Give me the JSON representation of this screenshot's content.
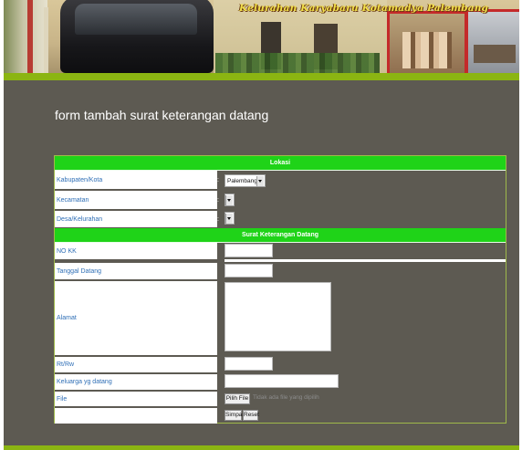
{
  "banner": {
    "title": "Kelurahan Karyabaru Kotamadya Palembang"
  },
  "form": {
    "title": "form tambah surat keterangan datang",
    "section_location": "Lokasi",
    "section_letter": "Surat Keterangan Datang",
    "colon": ":",
    "fields": {
      "kabupaten": {
        "label": "Kabupaten/Kota",
        "value": "Palembang"
      },
      "kecamatan": {
        "label": "Kecamatan",
        "value": ""
      },
      "kelurahan": {
        "label": "Desa/Kelurahan",
        "value": ""
      },
      "no_kk": {
        "label": "NO KK",
        "value": ""
      },
      "tanggal": {
        "label": "Tanggal Datang",
        "value": ""
      },
      "alamat": {
        "label": "Alamat",
        "value": ""
      },
      "rt_rw": {
        "label": "Rt/Rw",
        "value": ""
      },
      "keluarga": {
        "label": "Keluarga yg datang",
        "value": ""
      },
      "file": {
        "label": "File",
        "button": "Pilih File",
        "status": "Tidak ada file yang dipilih"
      }
    },
    "buttons": {
      "save": "Simpan",
      "reset": "Reset"
    }
  },
  "colors": {
    "page_bg": "#5d5a52",
    "section_header": "#1fd318",
    "accent_bar": "#8bb512",
    "label_text": "#2f6fb6"
  }
}
